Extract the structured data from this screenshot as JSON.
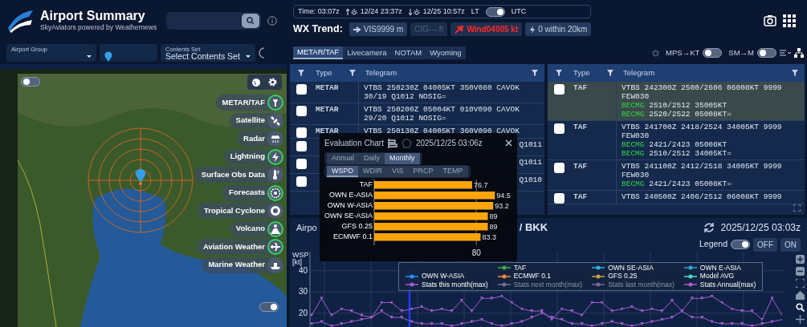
{
  "header": {
    "title": "Airport Summary",
    "subtitle": "SkyAviators powered by Weathernews"
  },
  "time_bar": {
    "time": "Time: 03:07z",
    "sunrise": "12/24 23:37z",
    "sunset": "12/25 10:57z",
    "lt_label": "LT",
    "utc_label": "UTC",
    "utc_on": true
  },
  "wx_trend": {
    "label": "WX Trend:",
    "items": [
      {
        "kind": "vis",
        "text": "VIS9999 m",
        "alert": false,
        "disabled": false
      },
      {
        "kind": "cig",
        "text": "CIG--- ft",
        "alert": false,
        "disabled": true
      },
      {
        "kind": "wind",
        "text": "Wind04005 kt",
        "alert": true,
        "disabled": false
      },
      {
        "kind": "lightning",
        "text": "0 within 20km",
        "alert": false,
        "disabled": false
      }
    ]
  },
  "filters": {
    "airport_group": {
      "label": "Airport Group"
    },
    "contents_set": {
      "label": "Contents Set",
      "value": "Select Contents Set"
    }
  },
  "tabs": [
    {
      "label": "METAR/TAF",
      "selected": true
    },
    {
      "label": "Livecamera",
      "selected": false
    },
    {
      "label": "NOTAM",
      "selected": false
    },
    {
      "label": "Wyoming",
      "selected": false
    }
  ],
  "unit_toggles": [
    {
      "label": "MPS→KT",
      "on": false
    },
    {
      "label": "SM→M",
      "on": false
    }
  ],
  "map": {
    "top_toggle_on": false,
    "bottom_toggle_on": true,
    "layers": [
      {
        "kind": "tower",
        "label": "METAR/TAF",
        "active": true
      },
      {
        "kind": "satellite",
        "label": "Satellite",
        "active": false
      },
      {
        "kind": "radar",
        "label": "Radar",
        "active": false
      },
      {
        "kind": "lightning",
        "label": "Lightning",
        "active": true
      },
      {
        "kind": "thermometer",
        "label": "Surface Obs Data",
        "active": false
      },
      {
        "kind": "forecast",
        "label": "Forecasts",
        "active": true
      },
      {
        "kind": "cyclone",
        "label": "Tropical Cyclone",
        "active": false
      },
      {
        "kind": "volcano",
        "label": "Volcano",
        "active": true
      },
      {
        "kind": "plane",
        "label": "Aviation Weather",
        "active": true
      },
      {
        "kind": "ship",
        "label": "Marine Weather",
        "active": false
      }
    ]
  },
  "metar_table": {
    "columns": [
      "Type",
      "Telegram"
    ],
    "rows": [
      {
        "checked": false,
        "selected": false,
        "type": "METAR",
        "lines": [
          {
            "text": "VTBS 250230Z 04005KT 350V080 CAVOK"
          },
          {
            "text": "30/19 Q1012 NOSIG="
          }
        ]
      },
      {
        "checked": false,
        "selected": false,
        "type": "METAR",
        "lines": [
          {
            "text": "VTBS 250200Z 05004KT 010V090 CAVOK"
          },
          {
            "text": "29/20 Q1012 NOSIG="
          }
        ]
      },
      {
        "checked": false,
        "selected": false,
        "type": "METAR",
        "lines": [
          {
            "text": "VTBS 250130Z 04005KT 360V090 CAVOK"
          }
        ]
      },
      {
        "checked": false,
        "selected": false,
        "tail": "Q1011"
      },
      {
        "checked": false,
        "selected": false,
        "tail": "Q1011"
      },
      {
        "checked": false,
        "selected": false,
        "tail": "Q1010"
      }
    ]
  },
  "taf_table": {
    "columns": [
      "Type",
      "Telegram"
    ],
    "rows": [
      {
        "checked": false,
        "selected": true,
        "type": "TAF",
        "lines": [
          {
            "text": "VTBS 242300Z 2500/2606 06008KT 9999"
          },
          {
            "text": "FEW030"
          },
          {
            "group": "BECMG",
            "text": "2510/2512 35005KT"
          },
          {
            "group": "BECMG",
            "text": "2520/2522 05008KT="
          }
        ]
      },
      {
        "checked": false,
        "selected": false,
        "type": "TAF",
        "lines": [
          {
            "text": "VTBS 241700Z 2418/2524 34005KT 9999"
          },
          {
            "text": "FEW030"
          },
          {
            "group": "BECMG",
            "text": "2421/2423 05008KT"
          },
          {
            "group": "BECMG",
            "text": "2510/2512 34005KT="
          }
        ]
      },
      {
        "checked": false,
        "selected": false,
        "type": "TAF",
        "lines": [
          {
            "text": "VTBS 241100Z 2412/2518 34005KT 9999"
          },
          {
            "text": "FEW030"
          },
          {
            "group": "BECMG",
            "text": "2421/2423 05008KT="
          }
        ]
      },
      {
        "checked": false,
        "selected": false,
        "type": "TAF",
        "lines": [
          {
            "text": "VTBS 240500Z 2406/2512 06008KT 9999"
          }
        ]
      }
    ]
  },
  "trend_chart": {
    "title_start": "Airpo",
    "title_end": "/ BKK",
    "time": "2025/12/25 03:03z",
    "legend_label": "Legend",
    "legend_on": true,
    "off_label": "OFF",
    "on_label": "ON",
    "legend": [
      {
        "visible": true
      },
      {
        "visible": true
      },
      {
        "visible": true
      },
      {
        "visible": true
      },
      {
        "visible": true
      },
      {
        "visible": true
      },
      {
        "visible": true
      },
      {
        "visible": true
      },
      {
        "visible": false
      },
      {
        "visible": false
      },
      {
        "visible": true
      }
    ],
    "chart_data": {
      "type": "line",
      "grid": true,
      "ylabel": "WSP [kt]",
      "yticks": [
        20,
        30,
        40
      ],
      "ylim": [
        13.5,
        49
      ],
      "series": [
        {
          "name": "TAF",
          "color": "#3cb043"
        },
        {
          "name": "OWN SE-ASIA",
          "color": "#29b6e0"
        },
        {
          "name": "OWN E-ASIA",
          "color": "#2aa6d8"
        },
        {
          "name": "OWN W-ASIA",
          "color": "#2196f3"
        },
        {
          "name": "ECMWF 0.1",
          "color": "#f08a3c"
        },
        {
          "name": "GFS 0.25",
          "color": "#c8a040"
        },
        {
          "name": "Model AVG",
          "color": "#40e0d0"
        },
        {
          "name": "Stats this month(max)",
          "color": "#a45ccf",
          "values": [
            15,
            16,
            14,
            15,
            16,
            17,
            18,
            21,
            18,
            18,
            16,
            15,
            15,
            15,
            14,
            15,
            16,
            17,
            15,
            14,
            15,
            16,
            18,
            20,
            18,
            17,
            15,
            15,
            14,
            15,
            16,
            15,
            14,
            15,
            16,
            17,
            18,
            21,
            18,
            18,
            16,
            15,
            15,
            15,
            14,
            15,
            16,
            17
          ]
        },
        {
          "name": "Stats next month(max)",
          "color": "#7a6a95"
        },
        {
          "name": "Stats last month(max)",
          "color": "#7a6a95"
        },
        {
          "name": "Stats Annual(max)",
          "color": "#a45ccf",
          "values": [
            19,
            27,
            19,
            22,
            21,
            19,
            18,
            25,
            25,
            21,
            22,
            23,
            21,
            22,
            21,
            26,
            21,
            27,
            27,
            28,
            25,
            22,
            21,
            21,
            17,
            22,
            21,
            19,
            25,
            25,
            21,
            22,
            23,
            21,
            22,
            21,
            26,
            21,
            27,
            27,
            28,
            25,
            22,
            21,
            21,
            17,
            27,
            19
          ]
        }
      ]
    }
  },
  "eval_chart": {
    "title": "Evaluation Chart",
    "time": "2025/12/25 03:06z",
    "periods": [
      {
        "label": "Annual",
        "selected": false
      },
      {
        "label": "Daily",
        "selected": false
      },
      {
        "label": "Monthly",
        "selected": true
      }
    ],
    "elements": [
      {
        "label": "WSPD",
        "selected": true
      },
      {
        "label": "WDIR",
        "selected": false
      },
      {
        "label": "VIS",
        "selected": false
      },
      {
        "label": "PRCP",
        "selected": false
      },
      {
        "label": "TEMP",
        "selected": false
      }
    ],
    "chart_data": {
      "type": "bar",
      "orientation": "horizontal",
      "categories": [
        "TAF",
        "OWN E-ASIA",
        "OWN W-ASIA",
        "OWN SE-ASIA",
        "GFS 0.25",
        "ECMWF 0.1"
      ],
      "values": [
        76.7,
        94.5,
        93.2,
        89,
        89,
        83.3
      ],
      "ref_lines": [
        {
          "axis": "x",
          "value": 80,
          "label": "80"
        }
      ],
      "data_labels": true
    }
  }
}
